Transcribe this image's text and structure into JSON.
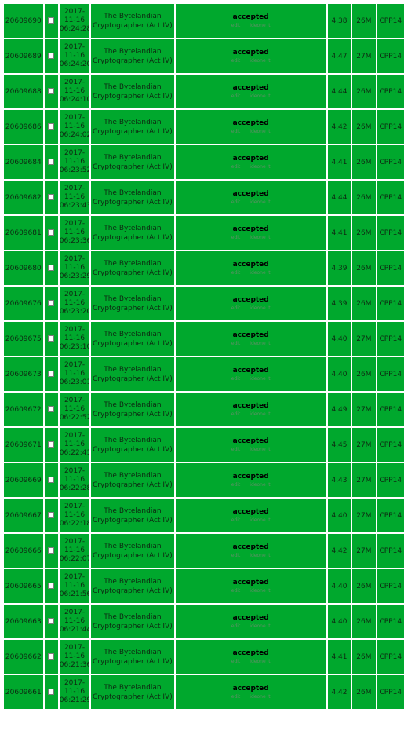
{
  "submissions": [
    {
      "id": "20609690",
      "date": "2017-11-16",
      "time": "06:24:28",
      "problem": "The Bytelandian Cryptographer (Act IV)",
      "result": "accepted",
      "edit": "edit",
      "ideone": "ideone it",
      "exec_time": "4.38",
      "memory": "26M",
      "lang": "CPP14"
    },
    {
      "id": "20609689",
      "date": "2017-11-16",
      "time": "06:24:20",
      "problem": "The Bytelandian Cryptographer (Act IV)",
      "result": "accepted",
      "edit": "edit",
      "ideone": "ideone it",
      "exec_time": "4.47",
      "memory": "27M",
      "lang": "CPP14"
    },
    {
      "id": "20609688",
      "date": "2017-11-16",
      "time": "06:24:10",
      "problem": "The Bytelandian Cryptographer (Act IV)",
      "result": "accepted",
      "edit": "edit",
      "ideone": "ideone it",
      "exec_time": "4.44",
      "memory": "26M",
      "lang": "CPP14"
    },
    {
      "id": "20609686",
      "date": "2017-11-16",
      "time": "06:24:02",
      "problem": "The Bytelandian Cryptographer (Act IV)",
      "result": "accepted",
      "edit": "edit",
      "ideone": "ideone it",
      "exec_time": "4.42",
      "memory": "26M",
      "lang": "CPP14"
    },
    {
      "id": "20609684",
      "date": "2017-11-16",
      "time": "06:23:52",
      "problem": "The Bytelandian Cryptographer (Act IV)",
      "result": "accepted",
      "edit": "edit",
      "ideone": "ideone it",
      "exec_time": "4.41",
      "memory": "26M",
      "lang": "CPP14"
    },
    {
      "id": "20609682",
      "date": "2017-11-16",
      "time": "06:23:43",
      "problem": "The Bytelandian Cryptographer (Act IV)",
      "result": "accepted",
      "edit": "edit",
      "ideone": "ideone it",
      "exec_time": "4.44",
      "memory": "26M",
      "lang": "CPP14"
    },
    {
      "id": "20609681",
      "date": "2017-11-16",
      "time": "06:23:36",
      "problem": "The Bytelandian Cryptographer (Act IV)",
      "result": "accepted",
      "edit": "edit",
      "ideone": "ideone it",
      "exec_time": "4.41",
      "memory": "26M",
      "lang": "CPP14"
    },
    {
      "id": "20609680",
      "date": "2017-11-16",
      "time": "06:23:29",
      "problem": "The Bytelandian Cryptographer (Act IV)",
      "result": "accepted",
      "edit": "edit",
      "ideone": "ideone it",
      "exec_time": "4.39",
      "memory": "26M",
      "lang": "CPP14"
    },
    {
      "id": "20609676",
      "date": "2017-11-16",
      "time": "06:23:20",
      "problem": "The Bytelandian Cryptographer (Act IV)",
      "result": "accepted",
      "edit": "edit",
      "ideone": "ideone it",
      "exec_time": "4.39",
      "memory": "26M",
      "lang": "CPP14"
    },
    {
      "id": "20609675",
      "date": "2017-11-16",
      "time": "06:23:10",
      "problem": "The Bytelandian Cryptographer (Act IV)",
      "result": "accepted",
      "edit": "edit",
      "ideone": "ideone it",
      "exec_time": "4.40",
      "memory": "27M",
      "lang": "CPP14"
    },
    {
      "id": "20609673",
      "date": "2017-11-16",
      "time": "06:23:01",
      "problem": "The Bytelandian Cryptographer (Act IV)",
      "result": "accepted",
      "edit": "edit",
      "ideone": "ideone it",
      "exec_time": "4.40",
      "memory": "26M",
      "lang": "CPP14"
    },
    {
      "id": "20609672",
      "date": "2017-11-16",
      "time": "06:22:52",
      "problem": "The Bytelandian Cryptographer (Act IV)",
      "result": "accepted",
      "edit": "edit",
      "ideone": "ideone it",
      "exec_time": "4.49",
      "memory": "27M",
      "lang": "CPP14"
    },
    {
      "id": "20609671",
      "date": "2017-11-16",
      "time": "06:22:41",
      "problem": "The Bytelandian Cryptographer (Act IV)",
      "result": "accepted",
      "edit": "edit",
      "ideone": "ideone it",
      "exec_time": "4.45",
      "memory": "27M",
      "lang": "CPP14"
    },
    {
      "id": "20609669",
      "date": "2017-11-16",
      "time": "06:22:28",
      "problem": "The Bytelandian Cryptographer (Act IV)",
      "result": "accepted",
      "edit": "edit",
      "ideone": "ideone it",
      "exec_time": "4.43",
      "memory": "27M",
      "lang": "CPP14"
    },
    {
      "id": "20609667",
      "date": "2017-11-16",
      "time": "06:22:18",
      "problem": "The Bytelandian Cryptographer (Act IV)",
      "result": "accepted",
      "edit": "edit",
      "ideone": "ideone it",
      "exec_time": "4.40",
      "memory": "27M",
      "lang": "CPP14"
    },
    {
      "id": "20609666",
      "date": "2017-11-16",
      "time": "06:22:07",
      "problem": "The Bytelandian Cryptographer (Act IV)",
      "result": "accepted",
      "edit": "edit",
      "ideone": "ideone it",
      "exec_time": "4.42",
      "memory": "27M",
      "lang": "CPP14"
    },
    {
      "id": "20609665",
      "date": "2017-11-16",
      "time": "06:21:56",
      "problem": "The Bytelandian Cryptographer (Act IV)",
      "result": "accepted",
      "edit": "edit",
      "ideone": "ideone it",
      "exec_time": "4.40",
      "memory": "26M",
      "lang": "CPP14"
    },
    {
      "id": "20609663",
      "date": "2017-11-16",
      "time": "06:21:44",
      "problem": "The Bytelandian Cryptographer (Act IV)",
      "result": "accepted",
      "edit": "edit",
      "ideone": "ideone it",
      "exec_time": "4.40",
      "memory": "26M",
      "lang": "CPP14"
    },
    {
      "id": "20609662",
      "date": "2017-11-16",
      "time": "06:21:36",
      "problem": "The Bytelandian Cryptographer (Act IV)",
      "result": "accepted",
      "edit": "edit",
      "ideone": "ideone it",
      "exec_time": "4.41",
      "memory": "26M",
      "lang": "CPP14"
    },
    {
      "id": "20609661",
      "date": "2017-11-16",
      "time": "06:21:29",
      "problem": "The Bytelandian Cryptographer (Act IV)",
      "result": "accepted",
      "edit": "edit",
      "ideone": "ideone it",
      "exec_time": "4.42",
      "memory": "26M",
      "lang": "CPP14"
    }
  ]
}
